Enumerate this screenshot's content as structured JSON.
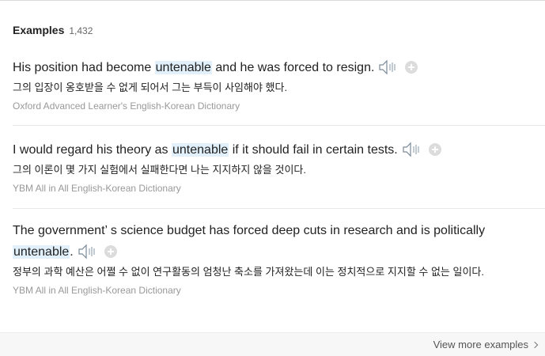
{
  "header": {
    "title": "Examples",
    "count": "1,432"
  },
  "examples": [
    {
      "before": "His position had become ",
      "highlight": "untenable",
      "after": " and he was forced to resign.",
      "translation": "그의 입장이 옹호받을 수 없게 되어서 그는 부득이 사임해야 했다.",
      "source": "Oxford Advanced Learner's English-Korean Dictionary"
    },
    {
      "before": "I would regard his theory as ",
      "highlight": "untenable",
      "after": " if it should fail in certain tests.",
      "translation": "그의 이론이 몇 가지 실험에서 실패한다면 나는 지지하지 않을 것이다.",
      "source": "YBM All in All English-Korean Dictionary"
    },
    {
      "before": "The government’ s science budget has forced deep cuts in research and is politically ",
      "highlight": "untenable",
      "after": ".",
      "translation": "정부의 과학 예산은 어쩔 수 없이 연구활동의 엄청난 축소를 가져왔는데 이는 정치적으로 지지할 수 없는 일이다.",
      "source": "YBM All in All English-Korean Dictionary"
    }
  ],
  "footer": {
    "more_label": "View more examples"
  },
  "colors": {
    "highlight": "#e1f0fb",
    "source_text": "#999999",
    "speaker_icon": "#7a8a99"
  },
  "icons": {
    "speaker": "speaker-icon",
    "add": "plus-icon",
    "more": "chevron-right-icon"
  }
}
